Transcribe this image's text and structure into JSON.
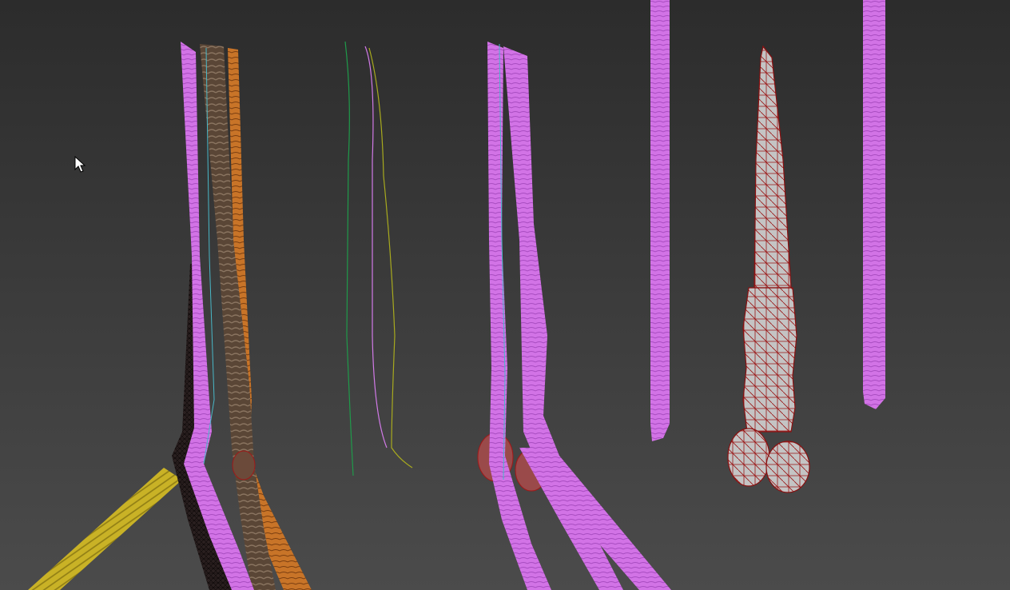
{
  "viewport": {
    "name": "3d-perspective-viewport",
    "background_top": "#2c2c2c",
    "background_bottom": "#4b4b4b"
  },
  "colors": {
    "magenta_wire": "#d273e6",
    "magenta_wire_dark": "#a84cc0",
    "brown_wire": "#5a4636",
    "brown_wire_light": "#8a7460",
    "orange_wire": "#c87428",
    "dark_wire": "#241a1a",
    "yellow_wire": "#c9b226",
    "yellow_wire_dark": "#8f7d14",
    "red_wire": "#a01818",
    "gray_shaded": "#bdbdbd",
    "spline_green": "#1f9a4a",
    "spline_magenta": "#d27ae8",
    "spline_yellow": "#a8aa1e",
    "spline_cyan": "#49b8c8",
    "cursor": "#ffffff"
  },
  "objects": [
    {
      "name": "twisted-hair-strand-group",
      "kind": "wireframe-mesh"
    },
    {
      "name": "spline-guides",
      "kind": "splines"
    },
    {
      "name": "magenta-strand-with-root",
      "kind": "wireframe-mesh"
    },
    {
      "name": "magenta-strand-straight",
      "kind": "wireframe-mesh"
    },
    {
      "name": "red-wire-base-mesh",
      "kind": "wireframe-shaded-mesh"
    },
    {
      "name": "magenta-strand-far-right",
      "kind": "wireframe-mesh"
    }
  ],
  "cursor": {
    "icon": "arrow-cursor-icon"
  }
}
